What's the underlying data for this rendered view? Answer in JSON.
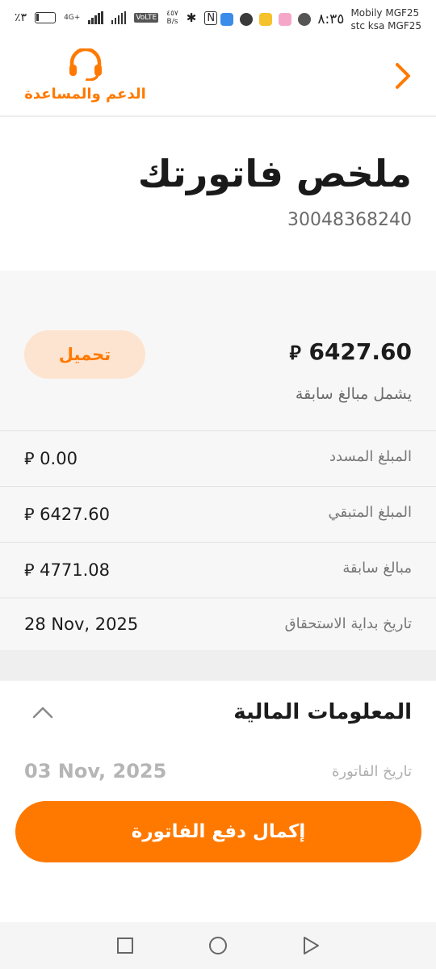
{
  "status_bar": {
    "battery": "٪٣",
    "network_4g": "4G+",
    "volte": "VoLTE",
    "speed_value": "٤٥٧",
    "speed_unit": "B/s",
    "time": "٨:٣٥",
    "carrier_1": "Mobily MGF25",
    "carrier_2": "stc ksa MGF25"
  },
  "header": {
    "support_label": "الدعم والمساعدة",
    "support_icon": "headset-icon",
    "back_icon": "chevron-right-icon",
    "accent": "#ff7900"
  },
  "bill": {
    "title": "ملخص فاتورتك",
    "account_number": "30048368240",
    "total": "6427.60",
    "currency_symbol": "⃁",
    "includes_previous": "يشمل مبالغ سابقة",
    "download_label": "تحميل"
  },
  "rows": [
    {
      "label": "المبلغ المسدد",
      "value": "0.00"
    },
    {
      "label": "المبلغ المتبقي",
      "value": "6427.60"
    },
    {
      "label": "مبالغ سابقة",
      "value": "4771.08"
    },
    {
      "label": "تاريخ بداية الاستحقاق",
      "value": "28 Nov, 2025"
    }
  ],
  "financial": {
    "title": "المعلومات المالية",
    "invoice_date_label": "تاريخ الفاتورة",
    "invoice_date_value": "03 Nov, 2025"
  },
  "pay_button": "إكمال دفع الفاتورة"
}
